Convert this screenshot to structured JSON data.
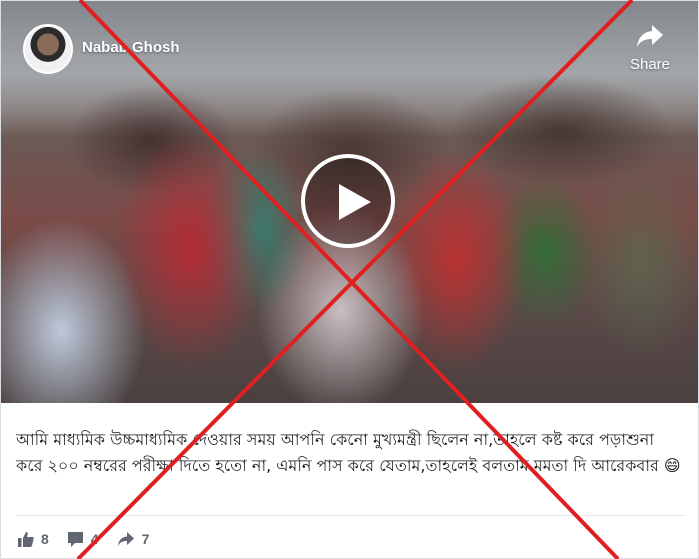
{
  "post": {
    "author": "Nabab Ghosh",
    "share_label": "Share",
    "caption": "আমি মাধ্যমিক উচ্চমাধ্যমিক দেওয়ার সময় আপনি কেনো মুখ্যমন্ত্রী ছিলেন না,তাহলে কষ্ট করে পড়াশুনা করে ২০০ নম্বরের পরীক্ষা দিতে হতো না, এমনি পাস করে যেতাম,তাহলেই বলতাম মমতা দি আরেকবার 😄",
    "likes": "8",
    "comments": "4",
    "shares": "7"
  },
  "icons": {
    "avatar": "avatar",
    "share": "share-arrow-icon",
    "play": "play-icon",
    "like": "thumbs-up-icon",
    "comment": "comment-icon",
    "reshare": "share-arrow-icon"
  },
  "colors": {
    "cross": "#e02020",
    "meta_text": "#606770"
  }
}
